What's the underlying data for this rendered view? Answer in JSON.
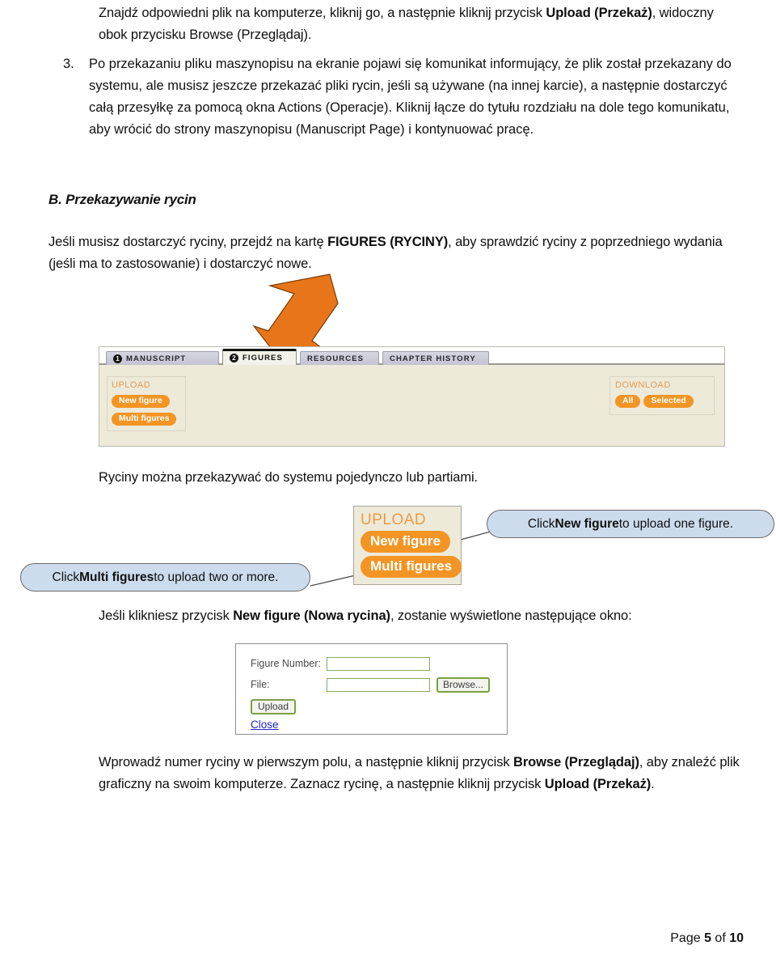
{
  "intro": {
    "text_1": "Znajdź odpowiedni plik na komputerze, kliknij go, a następnie kliknij przycisk ",
    "bold_1": "Upload (Przekaż)",
    "text_2": ", widoczny obok przycisku Browse (Przeglądaj)."
  },
  "list_item": {
    "number": "3.",
    "text": "Po przekazaniu pliku maszynopisu na ekranie pojawi się komunikat informujący, że plik został przekazany do systemu, ale musisz jeszcze przekazać pliki rycin, jeśli są używane (na innej karcie), a następnie dostarczyć całą przesyłkę za pomocą okna Actions (Operacje). Kliknij łącze do tytułu rozdziału na dole tego komunikatu, aby wrócić do strony maszynopisu (Manuscript Page) i kontynuować pracę."
  },
  "section": {
    "heading": "B. Przekazywanie rycin",
    "para_1": "Jeśli musisz dostarczyć ryciny, przejdź na kartę ",
    "para_bold": "FIGURES (RYCINY)",
    "para_2": ", aby sprawdzić ryciny z poprzedniego wydania (jeśli ma to zastosowanie) i dostarczyć nowe."
  },
  "app_screenshot": {
    "tabs": [
      {
        "badge": "1",
        "label": "MANUSCRIPT",
        "active": false
      },
      {
        "badge": "2",
        "label": "FIGURES",
        "active": true
      },
      {
        "badge": "",
        "label": "RESOURCES",
        "active": false
      },
      {
        "badge": "",
        "label": "CHAPTER HISTORY",
        "active": false
      }
    ],
    "upload": {
      "label": "UPLOAD",
      "buttons": [
        "New figure",
        "Multi figures"
      ]
    },
    "download": {
      "label": "DOWNLOAD",
      "buttons": [
        "All",
        "Selected"
      ]
    },
    "colors": {
      "pill": "#f39524",
      "panel_bg": "#edeada",
      "tab_active_bg": "#f2f2ea",
      "arrow": "#e8751a"
    }
  },
  "caption_a": "Ryciny można przekazywać do systemu pojedynczo lub partiami.",
  "upload_zoom": {
    "label": "UPLOAD",
    "buttons": [
      "New figure",
      "Multi figures"
    ]
  },
  "callouts": {
    "right": {
      "text_1": "Click ",
      "bold": "New figure",
      "text_2": " to upload one figure."
    },
    "left": {
      "text_1": "Click ",
      "bold": "Multi figures",
      "text_2": " to upload two or more."
    },
    "color": "#ccdced"
  },
  "caption_b": {
    "text_1": "Jeśli klikniesz przycisk ",
    "bold": "New figure (Nowa rycina)",
    "text_2": ", zostanie wyświetlone następujące okno:"
  },
  "dialog": {
    "figure_number_label": "Figure Number:",
    "figure_number_value": "",
    "file_label": "File:",
    "file_value": "",
    "browse_button": "Browse...",
    "upload_button": "Upload",
    "close_link": "Close"
  },
  "closing": {
    "text_1": "Wprowadź numer ryciny w pierwszym polu, a następnie kliknij przycisk ",
    "bold_1": "Browse (Przeglądaj)",
    "text_2": ", aby znaleźć plik graficzny na swoim komputerze. Zaznacz rycinę, a następnie kliknij przycisk ",
    "bold_2": "Upload (Przekaż)",
    "text_3": "."
  },
  "footer": {
    "prefix": "Page ",
    "page": "5",
    "middle": " of ",
    "total": "10"
  }
}
